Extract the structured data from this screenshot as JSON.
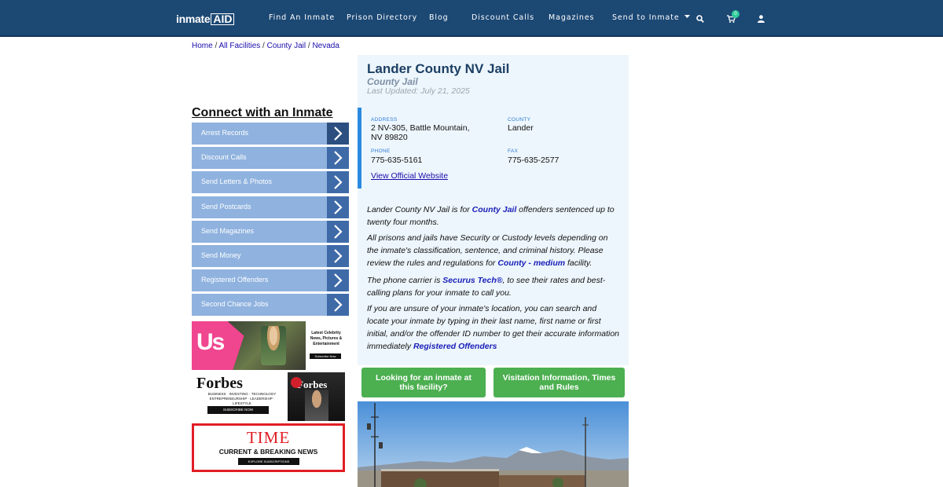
{
  "nav": {
    "logo_text": "inmate",
    "logo_box": "AID",
    "links": [
      "Find An Inmate",
      "Prison Directory",
      "Blog",
      "Discount Calls",
      "Magazines",
      "Send to Inmate"
    ],
    "cart_count": "0",
    "colors": {
      "navbar": "#1c4874",
      "badge": "#2ecc9a"
    },
    "icons": [
      "search-icon",
      "cart-icon",
      "user-icon",
      "caret-down-icon"
    ]
  },
  "breadcrumb": [
    "Home",
    "All Facilities",
    "County Jail",
    "Nevada"
  ],
  "connect": {
    "title": "Connect with an Inmate",
    "items": [
      "Arrest Records",
      "Discount Calls",
      "Send Letters & Photos",
      "Send Postcards",
      "Send Magazines",
      "Send Money",
      "Registered Offenders",
      "Second Chance Jobs"
    ]
  },
  "ads": {
    "us": {
      "logo": "Us",
      "text": "Latest Celebrity News, Pictures & Entertainment",
      "cta": "Subscribe Now"
    },
    "forbes": {
      "logo": "Forbes",
      "text": "BUSINESS · INVESTING · TECHNOLOGY ENTREPRENEURSHIP · LEADERSHIP · LIFESTYLE",
      "cta": "SUBSCRIBE NOW",
      "cover_logo": "Forbes"
    },
    "time": {
      "logo": "TIME",
      "text": "CURRENT & BREAKING NEWS",
      "cta": "EXPLORE SUBSCRIPTIONS"
    }
  },
  "facility": {
    "title": "Lander County NV Jail",
    "type": "County Jail",
    "last_updated": "Last Updated: July 21, 2025",
    "address_label": "ADDRESS",
    "address_line1": "2 NV-305, Battle Mountain,",
    "address_line2": "NV 89820",
    "county_label": "COUNTY",
    "county": "Lander",
    "phone_label": "PHONE",
    "phone": "775-635-5161",
    "fax_label": "FAX",
    "fax": "775-635-2577",
    "website_link": "View Official Website"
  },
  "description": {
    "p1_a": "Lander County NV Jail is for ",
    "p1_link": "County Jail",
    "p1_b": " offenders sentenced up to twenty four months.",
    "p2_a": "All prisons and jails have Security or Custody levels depending on the inmate's classification, sentence, and criminal history. Please review the rules and regulations for ",
    "p2_link": "County - medium",
    "p2_b": " facility.",
    "p3_a": "The phone carrier is ",
    "p3_link": "Securus Tech®",
    "p3_b": ", to see their rates and best-calling plans for your inmate to call you.",
    "p4_a": "If you are unsure of your inmate's location, you can search and locate your inmate by typing in their last name, first name or first initial, and/or the offender ID number to get their accurate information immediately ",
    "p4_link": "Registered Offenders"
  },
  "buttons": {
    "find": "Looking for an inmate at this facility?",
    "visit": "Visitation Information, Times and Rules"
  }
}
